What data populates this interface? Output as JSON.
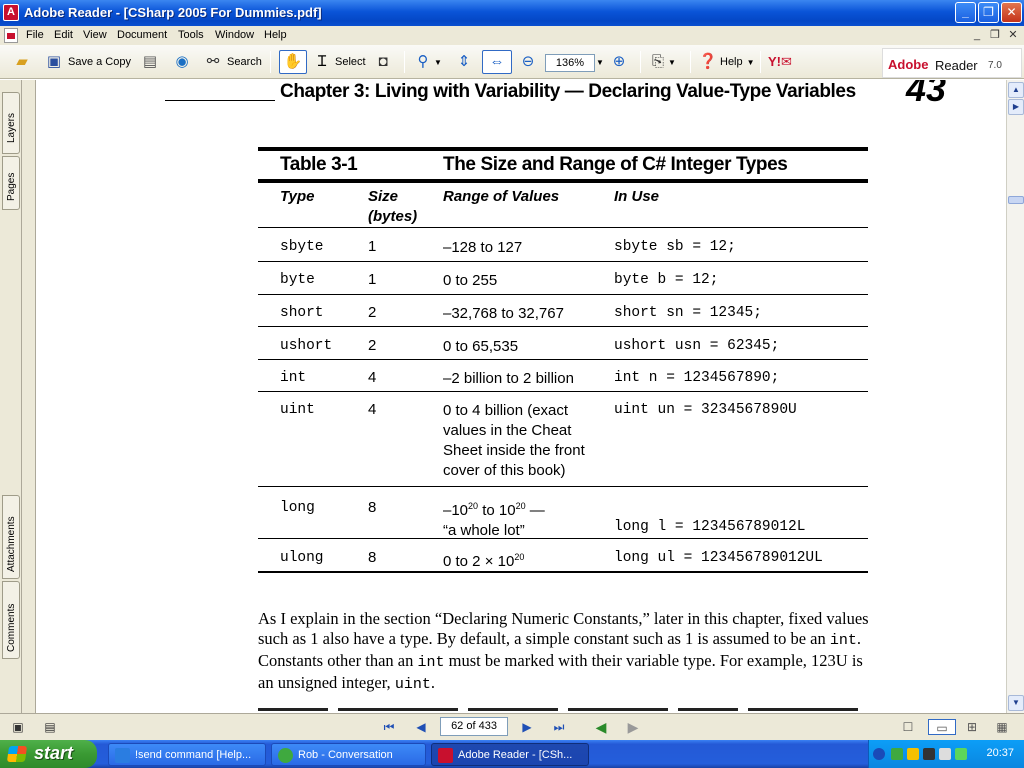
{
  "window": {
    "title": "Adobe Reader - [CSharp 2005 For Dummies.pdf]",
    "app_icon": "adobe-reader-icon"
  },
  "menu": [
    "File",
    "Edit",
    "View",
    "Document",
    "Tools",
    "Window",
    "Help"
  ],
  "toolbar": {
    "save_copy_label": "Save a Copy",
    "search_label": "Search",
    "select_label": "Select",
    "zoom_value": "136%",
    "help_label": "Help",
    "brand_adobe": "Adobe",
    "brand_reader": "Reader",
    "brand_version": "7.0"
  },
  "sidetabs": {
    "layers": "Layers",
    "pages": "Pages",
    "attachments": "Attachments",
    "comments": "Comments"
  },
  "document": {
    "chapter_heading": "Chapter 3: Living with Variability — Declaring Value-Type Variables",
    "page_number": "43",
    "table": {
      "number": "Table 3-1",
      "title": "The Size and Range of C# Integer Types",
      "headers": {
        "type": "Type",
        "size": "Size",
        "size2": "(bytes)",
        "range": "Range of Values",
        "use": "In Use"
      },
      "rows": [
        {
          "type": "sbyte",
          "size": "1",
          "range": "–128 to 127",
          "use": "sbyte sb = 12;"
        },
        {
          "type": "byte",
          "size": "1",
          "range": "0 to 255",
          "use": "byte b = 12;"
        },
        {
          "type": "short",
          "size": "2",
          "range": "–32,768 to 32,767",
          "use": "short sn = 12345;"
        },
        {
          "type": "ushort",
          "size": "2",
          "range": "0 to 65,535",
          "use": "ushort usn = 62345;"
        },
        {
          "type": "int",
          "size": "4",
          "range": "–2 billion to 2 billion",
          "use": "int n = 1234567890;"
        },
        {
          "type": "uint",
          "size": "4",
          "range": "0 to 4 billion (exact values in the Cheat Sheet inside the front cover of this book)",
          "use": "uint un = 3234567890U"
        },
        {
          "type": "long",
          "size": "8",
          "range_a": "–10",
          "range_sup1": "20",
          "range_b": " to 10",
          "range_sup2": "20",
          "range_c": " —",
          "range_line2": "“a whole lot”",
          "use": "long l = 123456789012L"
        },
        {
          "type": "ulong",
          "size": "8",
          "range_a": "0 to 2 × 10",
          "range_sup": "20",
          "use": "long ul = 123456789012UL"
        }
      ]
    },
    "paragraph": {
      "p1": "As I explain in the section “Declaring Numeric Constants,” later in this chapter, fixed values such as 1 also have a type. By default, a simple constant such as 1 is assumed to be an ",
      "c1": "int",
      "p2": ". Constants other than an ",
      "c2": "int",
      "p3": " must be marked with their variable type. For example, 123U is an unsigned integer, ",
      "c3": "uint",
      "p4": "."
    }
  },
  "statusbar": {
    "page_indicator": "62 of 433"
  },
  "taskbar": {
    "start_label": "start",
    "tasks": [
      "!send command [Help...",
      "Rob - Conversation",
      "Adobe Reader - [CSh..."
    ],
    "clock": "20:37"
  },
  "colors": {
    "title_blue": "#0a54d8",
    "taskbar_blue": "#245edb",
    "start_green": "#3a9a33",
    "adobe_red": "#c8102e",
    "chrome": "#ece9d8"
  }
}
